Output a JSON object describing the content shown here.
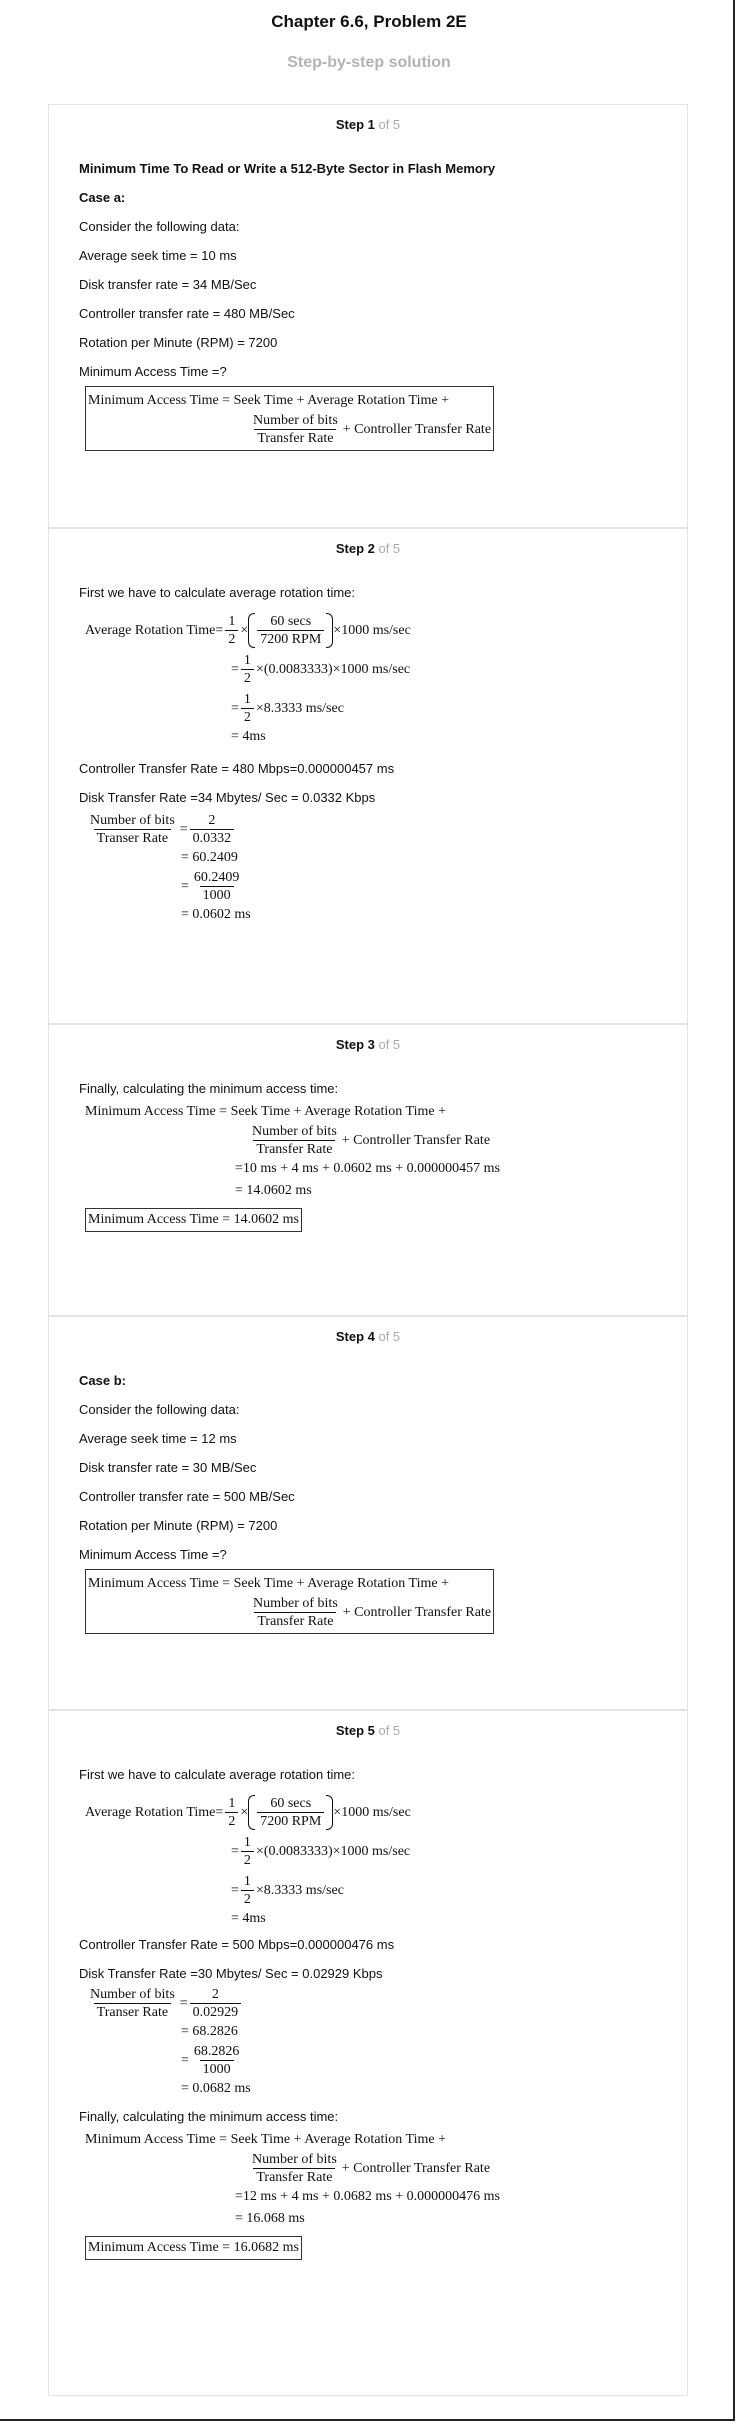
{
  "header": {
    "title": "Chapter 6.6, Problem 2E",
    "subtitle": "Step-by-step solution"
  },
  "steps": [
    {
      "num": "Step 1",
      "of": " of 5",
      "heading": "Minimum Time To Read or Write a 512-Byte Sector in Flash Memory",
      "case": "Case a:",
      "intro": "Consider the following data:",
      "items": [
        "Average seek time = 10 ms",
        "Disk transfer rate = 34 MB/Sec",
        "Controller transfer rate = 480 MB/Sec",
        "Rotation per Minute (RPM) = 7200",
        "Minimum Access Time =?"
      ],
      "formula": {
        "lhs": "Minimum Access Time = Seek Time + Average Rotation Time +",
        "num": "Number of bits",
        "den": "Transfer Rate",
        "rhs": "+ Controller Transfer Rate"
      }
    },
    {
      "num": "Step 2",
      "of": " of 5",
      "intro": "First we have to calculate average rotation time:",
      "rot": {
        "lhs": "Average Rotation Time",
        "half_num": "1",
        "half_den": "2",
        "paren_num": "60 secs",
        "paren_den": "7200 RPM",
        "tail": "×1000 ms/sec",
        "line2": "(0.0083333)×1000 ms/sec",
        "line3": "×8.3333 ms/sec",
        "line4": "= 4ms"
      },
      "ctrl": "Controller Transfer Rate = 480 Mbps=0.000000457 ms",
      "disk": "Disk Transfer Rate =34 Mbytes/ Sec = 0.0332 Kbps",
      "bits": {
        "num": "Number of bits",
        "den": "Transer Rate",
        "a_num": "2",
        "a_den": "0.0332",
        "b": "= 60.2409",
        "c_num": "60.2409",
        "c_den": "1000",
        "d": "= 0.0602 ms"
      }
    },
    {
      "num": "Step 3",
      "of": " of 5",
      "intro": "Finally, calculating the minimum access time:",
      "formula": {
        "lhs": "Minimum Access Time = Seek Time + Average Rotation Time +",
        "num": "Number of bits",
        "den": "Transfer Rate",
        "rhs": "+ Controller Transfer Rate"
      },
      "line2": "=10 ms + 4 ms + 0.0602 ms + 0.000000457 ms",
      "line3": "= 14.0602 ms",
      "answer": "Minimum Access Time = 14.0602 ms"
    },
    {
      "num": "Step 4",
      "of": " of 5",
      "case": "Case b:",
      "intro": "Consider the following data:",
      "items": [
        "Average seek time = 12 ms",
        "Disk transfer rate = 30 MB/Sec",
        "Controller transfer rate = 500 MB/Sec",
        "Rotation per Minute (RPM) = 7200",
        "Minimum Access Time =?"
      ],
      "formula": {
        "lhs": "Minimum Access Time = Seek Time + Average Rotation Time +",
        "num": "Number of bits",
        "den": "Transfer Rate",
        "rhs": "+ Controller Transfer Rate"
      }
    },
    {
      "num": "Step 5",
      "of": " of 5",
      "intro": "First we have to calculate average rotation time:",
      "rot": {
        "lhs": "Average Rotation Time",
        "half_num": "1",
        "half_den": "2",
        "paren_num": "60 secs",
        "paren_den": "7200 RPM",
        "tail": "×1000 ms/sec",
        "line2": "(0.0083333)×1000 ms/sec",
        "line3": "×8.3333 ms/sec",
        "line4": "= 4ms"
      },
      "ctrl": "Controller Transfer Rate = 500 Mbps=0.000000476 ms",
      "disk": "Disk Transfer Rate =30 Mbytes/ Sec = 0.02929 Kbps",
      "bits": {
        "num": "Number of bits",
        "den": "Transer Rate",
        "a_num": "2",
        "a_den": "0.02929",
        "b": "= 68.2826",
        "c_num": "68.2826",
        "c_den": "1000",
        "d": "= 0.0682 ms"
      },
      "final_intro": "Finally, calculating the minimum access time:",
      "formula": {
        "lhs": "Minimum Access Time = Seek Time + Average Rotation Time +",
        "num": "Number of bits",
        "den": "Transfer Rate",
        "rhs": "+ Controller Transfer Rate"
      },
      "line2": "=12 ms + 4 ms + 0.0682 ms + 0.000000476 ms",
      "line3": "= 16.068 ms",
      "answer": "Minimum Access Time = 16.0682 ms"
    }
  ]
}
